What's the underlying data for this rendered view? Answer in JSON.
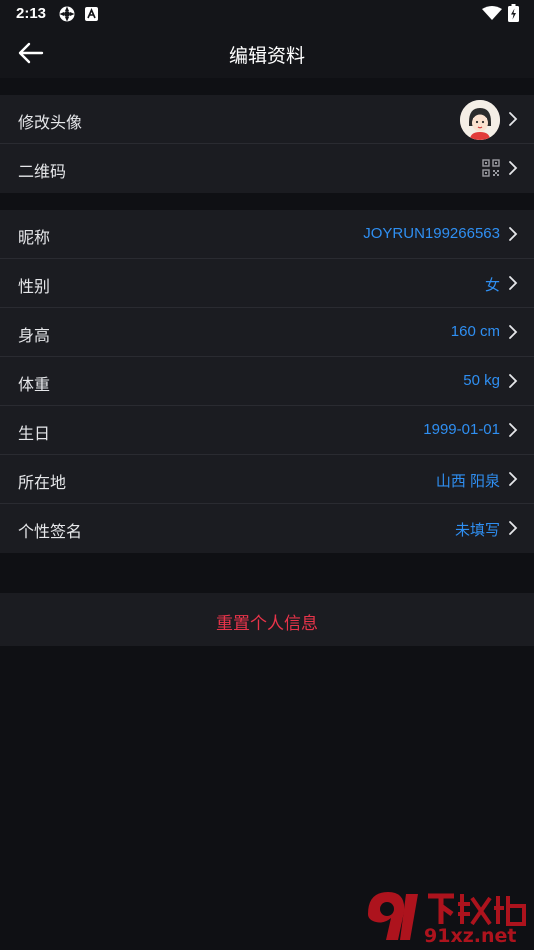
{
  "status_bar": {
    "time": "2:13",
    "icons": [
      "settings-sync-icon",
      "a-badge-icon",
      "wifi-icon",
      "battery-charging-icon"
    ]
  },
  "app_bar": {
    "title": "编辑资料",
    "back_icon": "arrow-left-icon"
  },
  "section_profile": [
    {
      "label": "修改头像",
      "value_type": "avatar"
    },
    {
      "label": "二维码",
      "value_type": "qr-icon"
    }
  ],
  "section_info": [
    {
      "label": "昵称",
      "value": "JOYRUN199266563"
    },
    {
      "label": "性别",
      "value": "女"
    },
    {
      "label": "身高",
      "value": "160 cm"
    },
    {
      "label": "体重",
      "value": "50 kg"
    },
    {
      "label": "生日",
      "value": "1999-01-01"
    },
    {
      "label": "所在地",
      "value": "山西 阳泉"
    },
    {
      "label": "个性签名",
      "value": "未填写"
    }
  ],
  "reset_button": "重置个人信息",
  "watermark": {
    "brand_cn": "下载站",
    "brand_en": "91xz.net"
  },
  "colors": {
    "background": "#0f1014",
    "row_background": "#1b1c21",
    "value_blue": "#2f8ff2",
    "reset_red": "#e8344a"
  }
}
